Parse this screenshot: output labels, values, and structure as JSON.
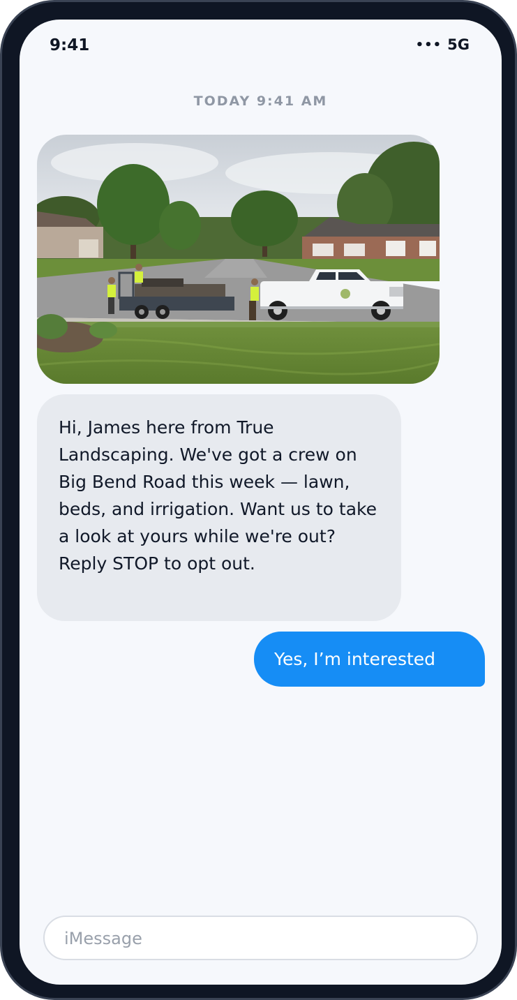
{
  "status_bar": {
    "time": "9:41",
    "signal": "•••",
    "network": "5G"
  },
  "conversation": {
    "timestamp": "TODAY 9:41 AM",
    "photo": {
      "icon": "photo-landscaping-crew-truck-trailer"
    },
    "incoming_message": "Hi, James here from True Landscaping. We've got a crew on Big Bend Road this week — lawn, beds, and irrigation. Want us to take a look at yours while we're out? Reply STOP to opt out.",
    "outgoing_message": "Yes, I’m interested"
  },
  "composer": {
    "placeholder": "iMessage",
    "value": ""
  },
  "colors": {
    "frame": "#0f1624",
    "screen_bg": "#f6f8fc",
    "incoming_bubble": "#e7eaef",
    "outgoing_bubble": "#168df5",
    "timestamp_text": "#8f97a4"
  }
}
